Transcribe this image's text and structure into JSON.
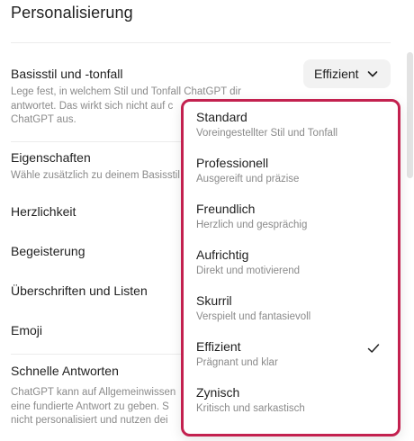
{
  "page": {
    "title": "Personalisierung"
  },
  "base_style": {
    "label": "Basisstil und -tonfall",
    "description_lines": [
      "Lege fest, in welchem Stil und Tonfall ChatGPT dir",
      "antwortet. Das wirkt sich nicht auf c",
      "ChatGPT aus."
    ],
    "selected": "Effizient"
  },
  "traits": {
    "label": "Eigenschaften",
    "description": "Wähle zusätzlich zu deinem Basisstil"
  },
  "settings": [
    {
      "label": "Herzlichkeit"
    },
    {
      "label": "Begeisterung"
    },
    {
      "label": "Überschriften und Listen"
    },
    {
      "label": "Emoji"
    }
  ],
  "fast_answers": {
    "label": "Schnelle Antworten",
    "description_lines": [
      "ChatGPT kann auf Allgemeinwissen",
      "eine fundierte Antwort zu geben. S",
      "nicht personalisiert und nutzen dei"
    ]
  },
  "dropdown": {
    "options": [
      {
        "title": "Standard",
        "subtitle": "Voreingestellter Stil und Tonfall",
        "selected": false
      },
      {
        "title": "Professionell",
        "subtitle": "Ausgereift und präzise",
        "selected": false
      },
      {
        "title": "Freundlich",
        "subtitle": "Herzlich und gesprächig",
        "selected": false
      },
      {
        "title": "Aufrichtig",
        "subtitle": "Direkt und motivierend",
        "selected": false
      },
      {
        "title": "Skurril",
        "subtitle": "Verspielt und fantasievoll",
        "selected": false
      },
      {
        "title": "Effizient",
        "subtitle": "Prägnant und klar",
        "selected": true
      },
      {
        "title": "Zynisch",
        "subtitle": "Kritisch und sarkastisch",
        "selected": false
      }
    ]
  },
  "colors": {
    "highlight_border": "#c3214f",
    "muted_text": "#8a8a8a"
  },
  "icons": {
    "select": "chevron-down-icon",
    "selected_option": "checkmark-icon"
  }
}
